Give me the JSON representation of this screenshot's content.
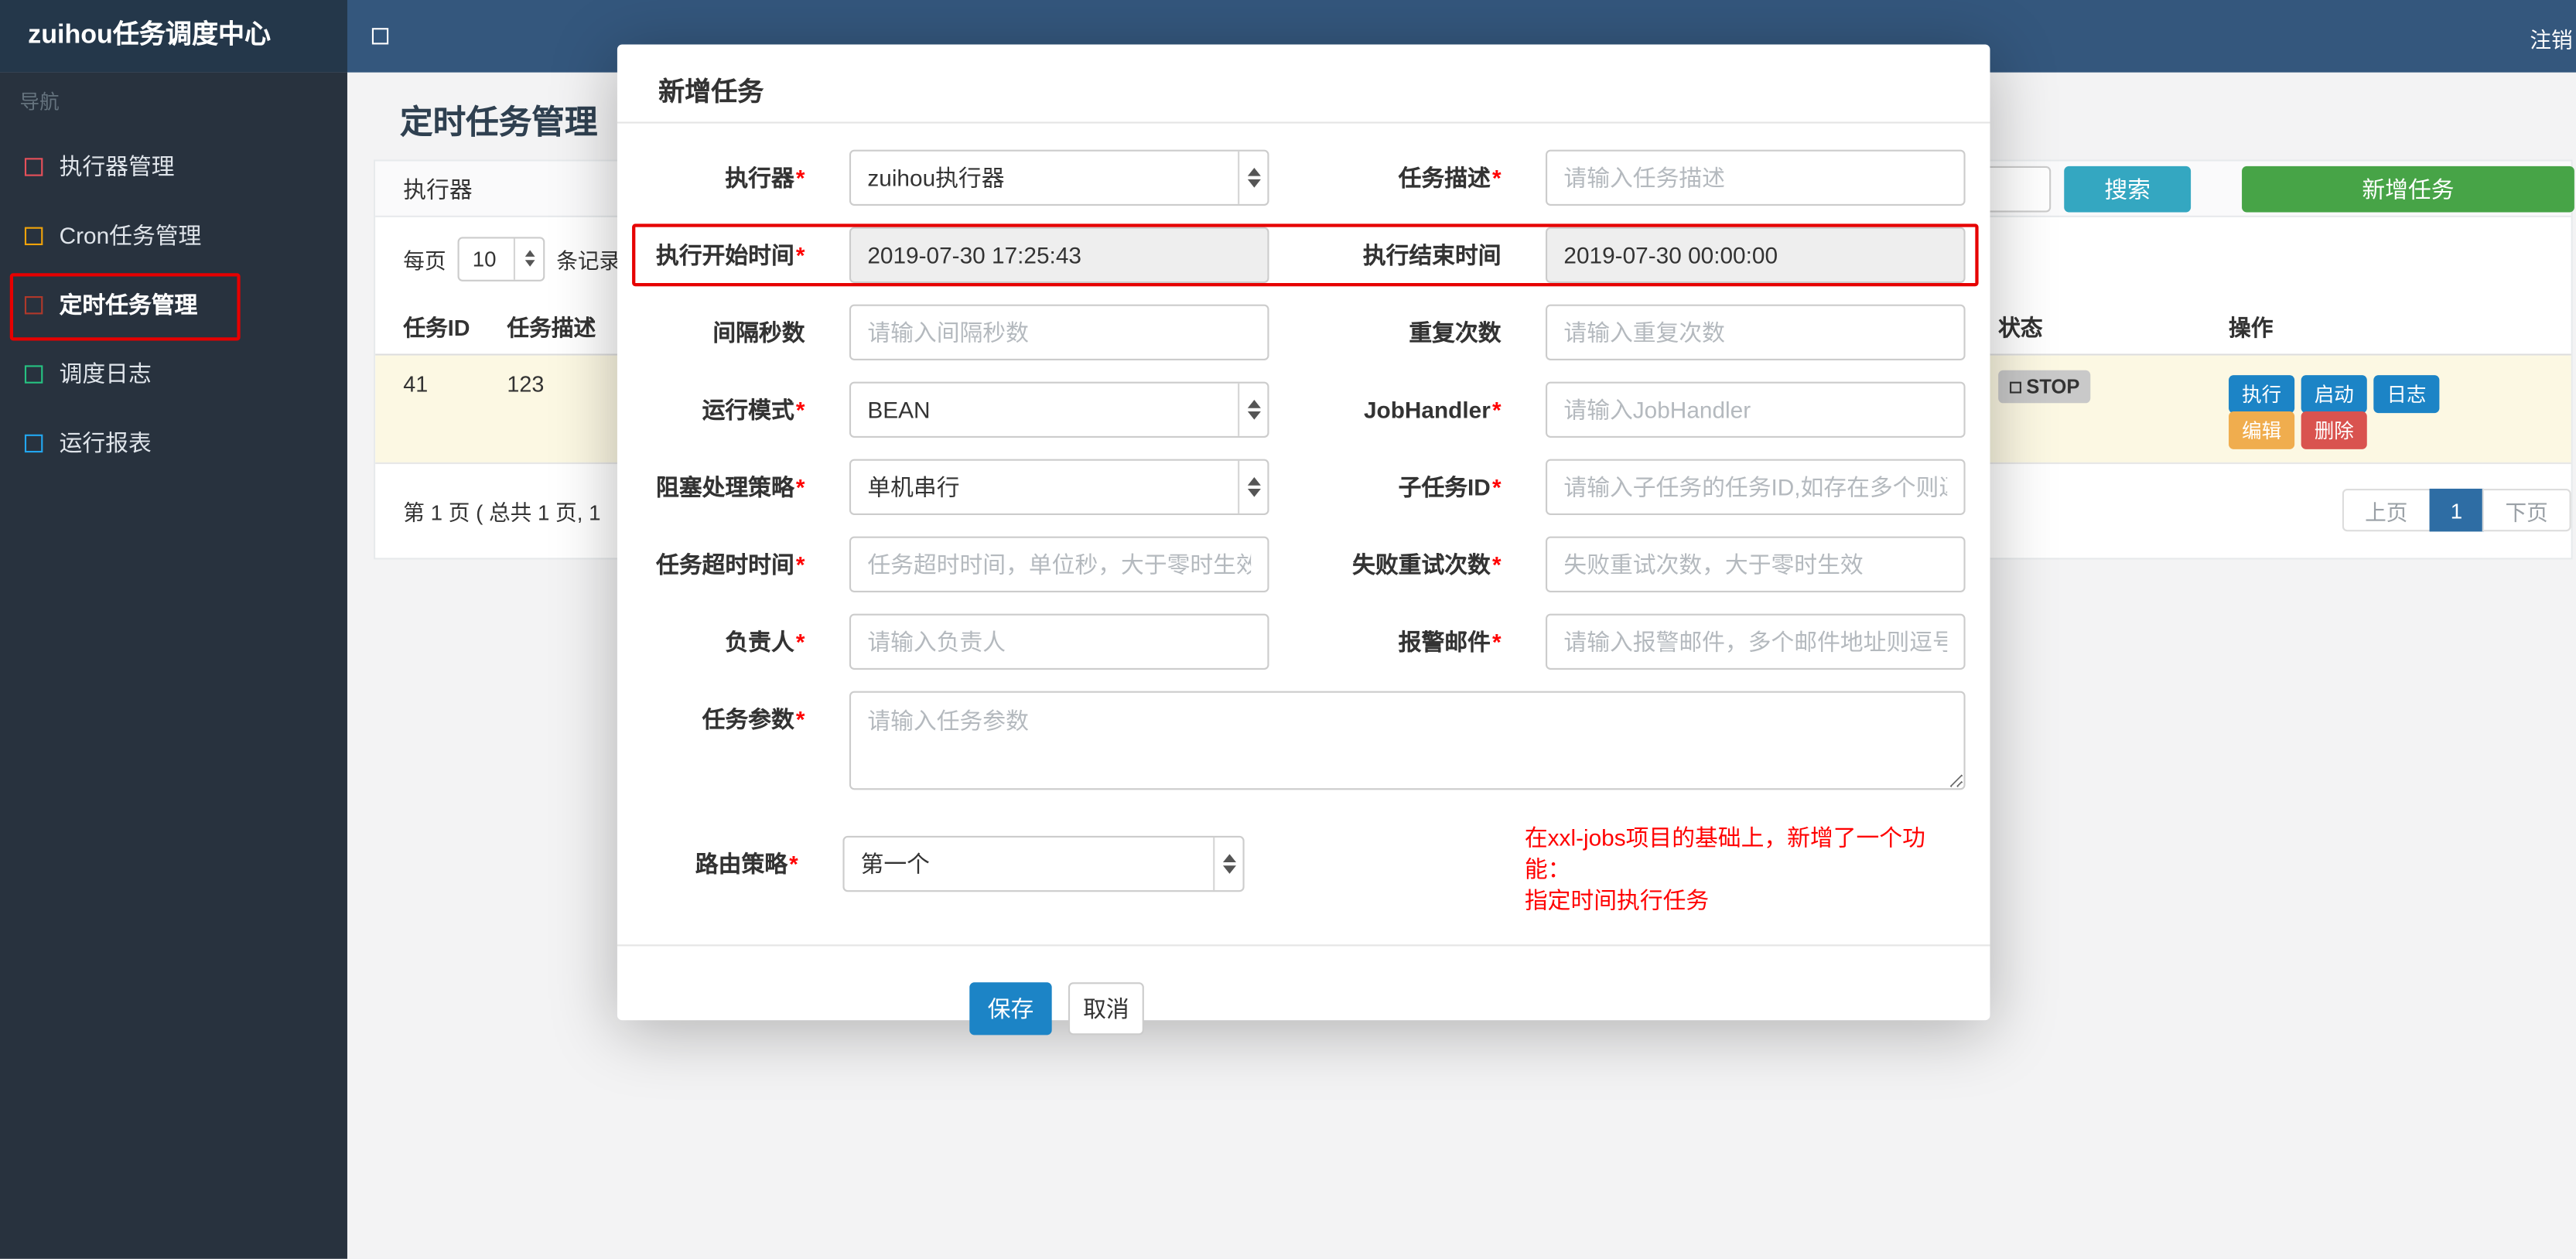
{
  "navbar": {
    "brand": "zuihou任务调度中心",
    "logout": "注销"
  },
  "sidebar": {
    "section_label": "导航",
    "items": [
      {
        "label": "执行器管理"
      },
      {
        "label": "Cron任务管理"
      },
      {
        "label": "定时任务管理"
      },
      {
        "label": "调度日志"
      },
      {
        "label": "运行报表"
      }
    ]
  },
  "page": {
    "title": "定时任务管理",
    "filter": {
      "executor_label": "执行器",
      "search_button": "搜索",
      "add_button": "新增任务"
    },
    "per_page": {
      "prefix": "每页",
      "value": "10",
      "suffix": "条记录"
    },
    "table": {
      "headers": {
        "id": "任务ID",
        "desc": "任务描述",
        "status": "状态",
        "actions": "操作"
      },
      "row": {
        "id": "41",
        "desc": "123",
        "status": "STOP",
        "actions": {
          "run": "执行",
          "start": "启动",
          "log": "日志",
          "edit": "编辑",
          "delete": "删除"
        }
      }
    },
    "footer": {
      "summary": "第 1 页 ( 总共 1 页, 1",
      "prev": "上页",
      "current": "1",
      "next": "下页"
    }
  },
  "modal": {
    "title": "新增任务",
    "required_mark": "*",
    "fields": {
      "executor": {
        "label": "执行器",
        "value": "zuihou执行器"
      },
      "job_desc": {
        "label": "任务描述",
        "placeholder": "请输入任务描述"
      },
      "start_time": {
        "label": "执行开始时间",
        "value": "2019-07-30 17:25:43"
      },
      "end_time": {
        "label": "执行结束时间",
        "value": "2019-07-30 00:00:00"
      },
      "interval_seconds": {
        "label": "间隔秒数",
        "placeholder": "请输入间隔秒数"
      },
      "repeat_count": {
        "label": "重复次数",
        "placeholder": "请输入重复次数"
      },
      "run_mode": {
        "label": "运行模式",
        "value": "BEAN"
      },
      "job_handler": {
        "label": "JobHandler",
        "placeholder": "请输入JobHandler"
      },
      "block_strategy": {
        "label": "阻塞处理策略",
        "value": "单机串行"
      },
      "child_job_id": {
        "label": "子任务ID",
        "placeholder": "请输入子任务的任务ID,如存在多个则逗号分隔"
      },
      "timeout": {
        "label": "任务超时时间",
        "placeholder": "任务超时时间，单位秒，大于零时生效"
      },
      "retry_count": {
        "label": "失败重试次数",
        "placeholder": "失败重试次数，大于零时生效"
      },
      "owner": {
        "label": "负责人",
        "placeholder": "请输入负责人"
      },
      "alarm_email": {
        "label": "报警邮件",
        "placeholder": "请输入报警邮件，多个邮件地址则逗号分隔"
      },
      "job_param": {
        "label": "任务参数",
        "placeholder": "请输入任务参数"
      },
      "route_strategy": {
        "label": "路由策略",
        "value": "第一个"
      }
    },
    "note": {
      "line1": "在xxl-jobs项目的基础上，新增了一个功能：",
      "line2": "指定时间执行任务"
    },
    "buttons": {
      "save": "保存",
      "cancel": "取消"
    }
  },
  "colors": {
    "navbar_bg": "#34577d",
    "brand_bg": "#24374a",
    "sidebar_bg": "#28323e",
    "search_button": "#34a7c1",
    "add_button": "#47a447",
    "primary_blue": "#1c84c6",
    "edit_orange": "#f0ad4e",
    "delete_red": "#d9534f",
    "active_page": "#2e6da4",
    "annotation_red": "#e60000",
    "note_red": "#ff0000",
    "row_highlight": "#fcf8e3"
  }
}
